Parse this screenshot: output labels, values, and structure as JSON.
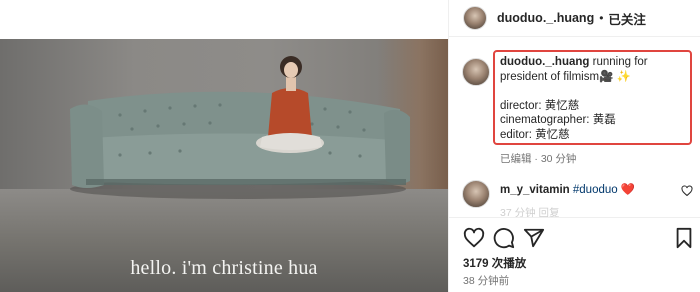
{
  "post": {
    "image_caption": "hello. i'm christine hua"
  },
  "header": {
    "username": "duoduo._.huang",
    "dot": "•",
    "follow_status": "已关注"
  },
  "caption": {
    "username": "duoduo._.huang",
    "text": " running for president of filmism🎥 ✨",
    "lines": [
      "director: 黄忆慈",
      "cinematographer: 黄磊",
      "editor: 黄忆慈"
    ],
    "meta": "已编辑 · 30 分钟"
  },
  "comment": {
    "username": "m_y_vitamin",
    "hashtag": "#duoduo",
    "emoji": "❤️",
    "sub": "37 分钟  回复"
  },
  "actions": {
    "like_icon": "heart-icon",
    "comment_icon": "comment-icon",
    "share_icon": "share-icon",
    "save_icon": "bookmark-icon"
  },
  "stats": {
    "views": "3179 次播放",
    "time": "38 分钟前"
  },
  "colors": {
    "highlight_border": "#e0453f",
    "heart": "#ed4956",
    "hashtag": "#00376b"
  }
}
